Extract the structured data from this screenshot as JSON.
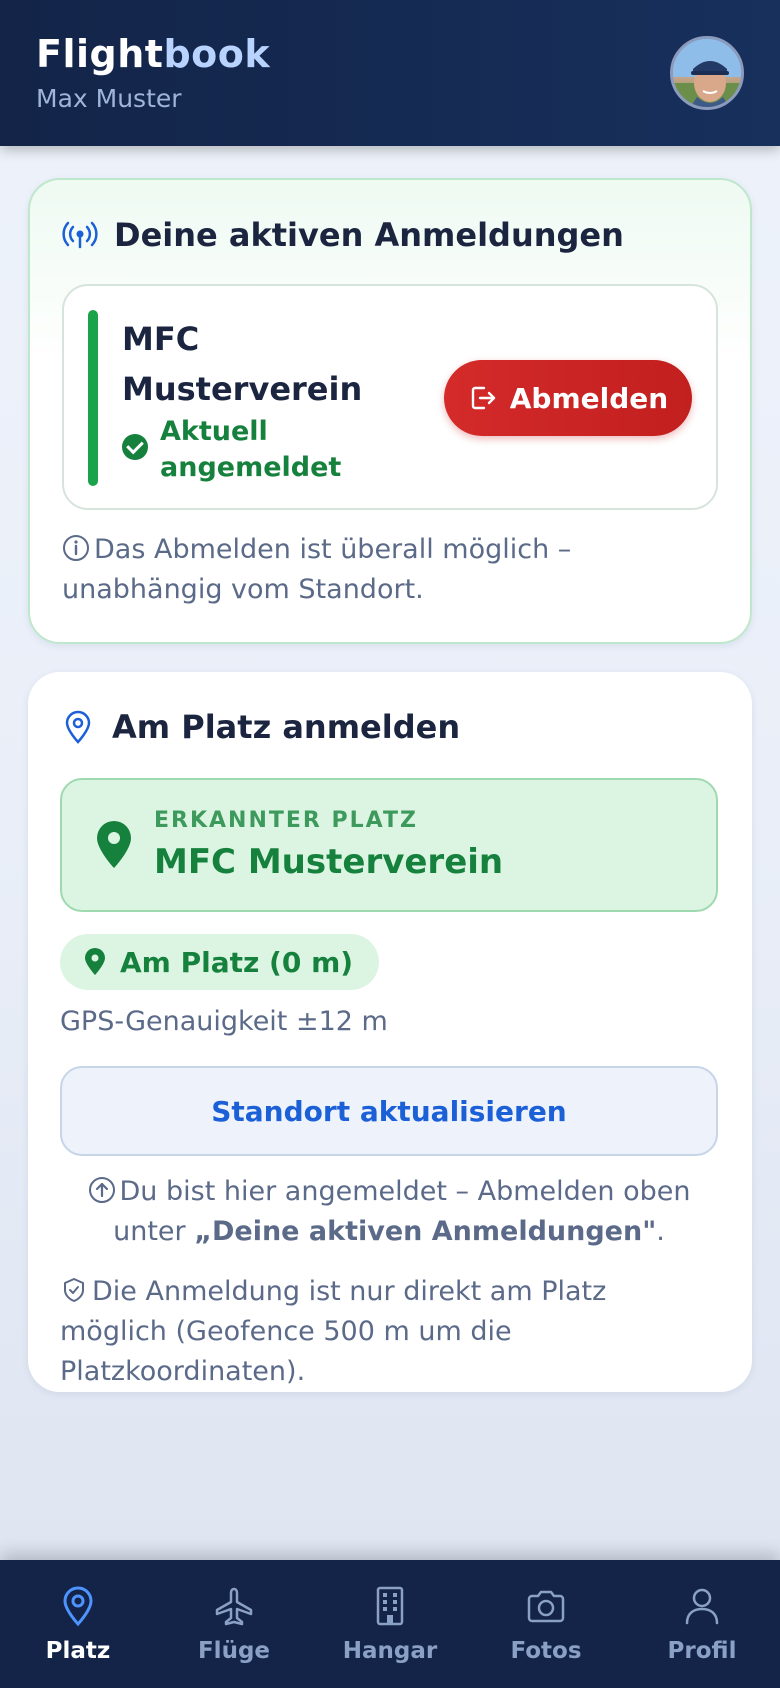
{
  "header": {
    "brand_part1": "Flight",
    "brand_part2": "book",
    "user_name": "Max Muster"
  },
  "active": {
    "title": "Deine aktiven Anmeldungen",
    "club_name": "MFC Musterverein",
    "status": "Aktuell angemeldet",
    "logout_label": "Abmelden",
    "note": "Das Abmelden ist überall möglich – unabhängig vom Standort."
  },
  "checkin": {
    "title": "Am Platz anmelden",
    "detected_label": "ERKANNTER PLATZ",
    "detected_name": "MFC Musterverein",
    "distance": "Am Platz (0 m)",
    "gps_accuracy": "GPS-Genauigkeit ±12 m",
    "update_label": "Standort aktualisieren",
    "hint_prefix": "Du bist hier angemeldet – Abmelden oben unter ",
    "hint_link": "„Deine aktiven Anmeldungen\"",
    "hint_suffix": ".",
    "geofence_note": "Die Anmeldung ist nur direkt am Platz möglich (Geofence 500 m um die Platzkoordinaten)."
  },
  "nav": {
    "items": [
      {
        "label": "Platz",
        "icon": "map-pin-icon",
        "active": true
      },
      {
        "label": "Flüge",
        "icon": "airplane-icon",
        "active": false
      },
      {
        "label": "Hangar",
        "icon": "building-icon",
        "active": false
      },
      {
        "label": "Fotos",
        "icon": "camera-icon",
        "active": false
      },
      {
        "label": "Profil",
        "icon": "user-icon",
        "active": false
      }
    ]
  },
  "colors": {
    "header_bg": "#132448",
    "accent_blue": "#1c60d8",
    "success_green": "#16813d",
    "danger_red": "#d42a2a"
  }
}
